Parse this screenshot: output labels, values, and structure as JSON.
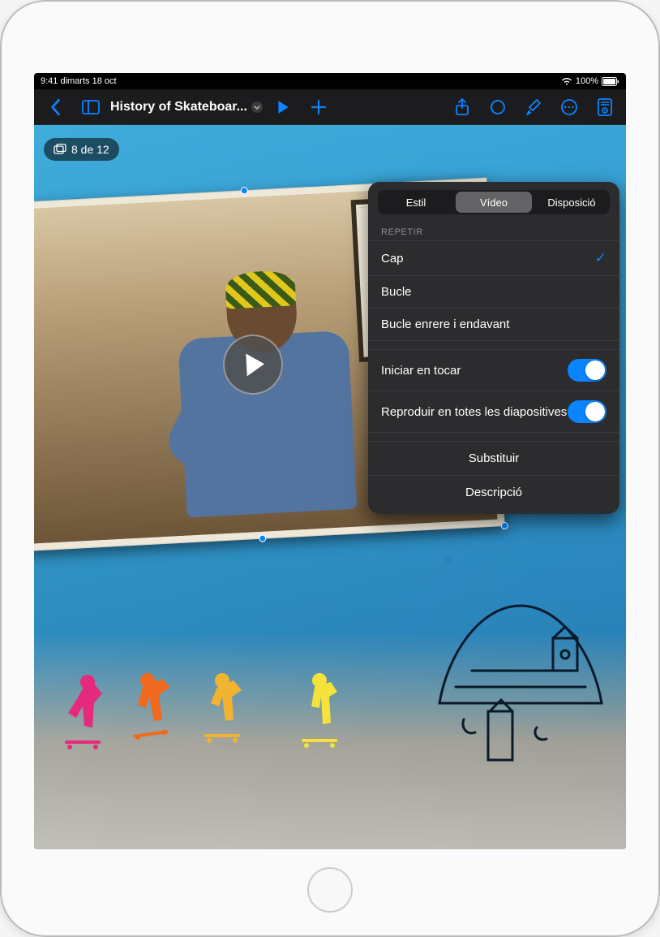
{
  "status": {
    "time_date": "9:41 dimarts 18 oct",
    "battery_pct": "100%"
  },
  "toolbar": {
    "document_title": "History of Skateboar..."
  },
  "slide": {
    "counter": "8 de 12"
  },
  "popover": {
    "tabs": {
      "style": "Estil",
      "video": "Vídeo",
      "layout": "Disposició"
    },
    "active_tab": "video",
    "section_repeat": "REPETIR",
    "repeat_options": {
      "none": "Cap",
      "loop": "Bucle",
      "loop_bf": "Bucle enrere i endavant"
    },
    "repeat_selected": "none",
    "toggles": {
      "start_on_tap": "Iniciar en tocar",
      "play_all_slides": "Reproduir en totes les diapositives"
    },
    "actions": {
      "replace": "Substituir",
      "description": "Descripció"
    }
  }
}
